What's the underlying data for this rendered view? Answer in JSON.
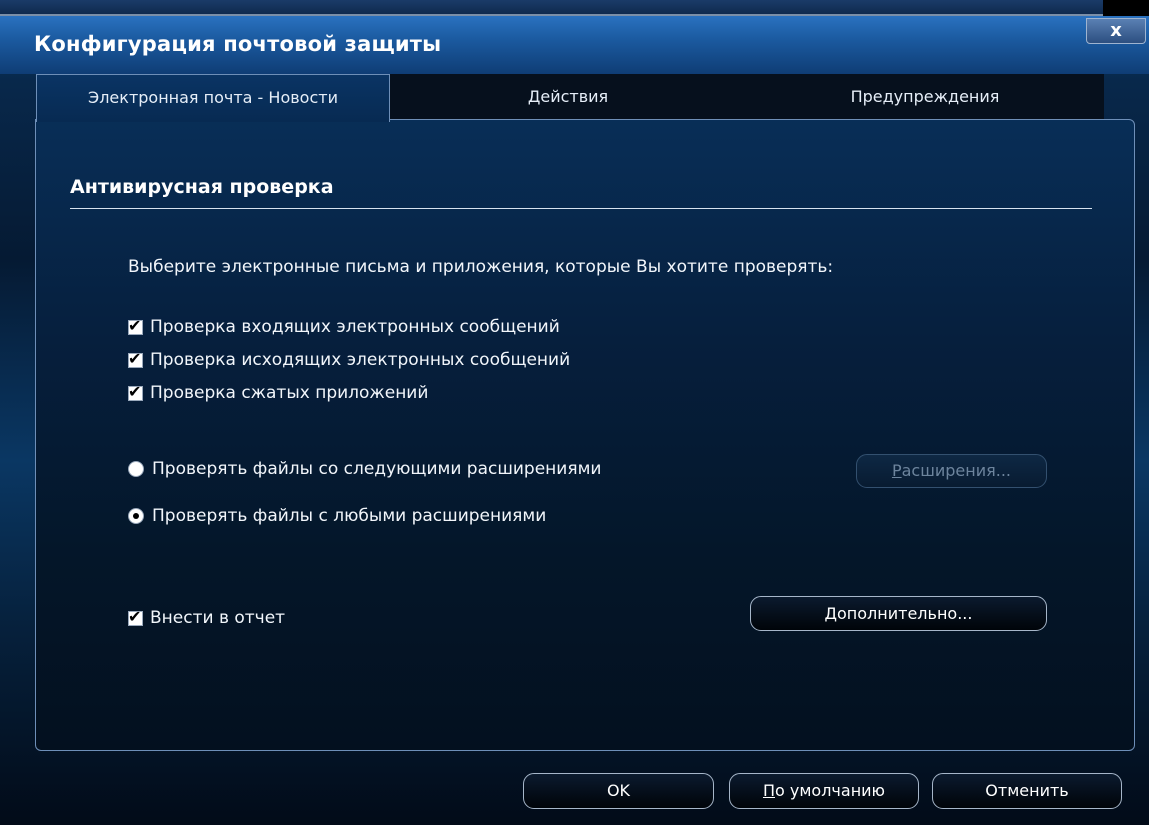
{
  "window": {
    "title": "Конфигурация почтовой защиты",
    "close_label": "x"
  },
  "tabs": [
    {
      "label": "Электронная почта - Новости",
      "active": true
    },
    {
      "label": "Действия",
      "active": false
    },
    {
      "label": "Предупреждения",
      "active": false
    }
  ],
  "panel": {
    "section_title": "Антивирусная проверка",
    "prompt": "Выберите электронные письма и приложения, которые Вы хотите проверять:",
    "checkboxes": [
      {
        "label": "Проверка входящих электронных сообщений",
        "checked": true
      },
      {
        "label": "Проверка исходящих электронных сообщений",
        "checked": true
      },
      {
        "label": "Проверка сжатых приложений",
        "checked": true
      }
    ],
    "radios": [
      {
        "label": "Проверять файлы со следующими расширениями",
        "selected": false
      },
      {
        "label": "Проверять файлы с любыми расширениями",
        "selected": true
      }
    ],
    "extensions_button": {
      "mnemonic": "Р",
      "rest": "асширения...",
      "enabled": false
    },
    "report_checkbox": {
      "label": "Внести в отчет",
      "checked": true
    },
    "advanced_button": {
      "mnemonic": "Д",
      "rest": "ополнительно..."
    }
  },
  "footer": {
    "ok_label": "OK",
    "default_mnemonic": "П",
    "default_rest": "о умолчанию",
    "cancel_label": "Отменить"
  },
  "colors": {
    "titlebar": "#1b5aa0",
    "panel_border": "#6e8fb8",
    "background": "#051a33"
  }
}
